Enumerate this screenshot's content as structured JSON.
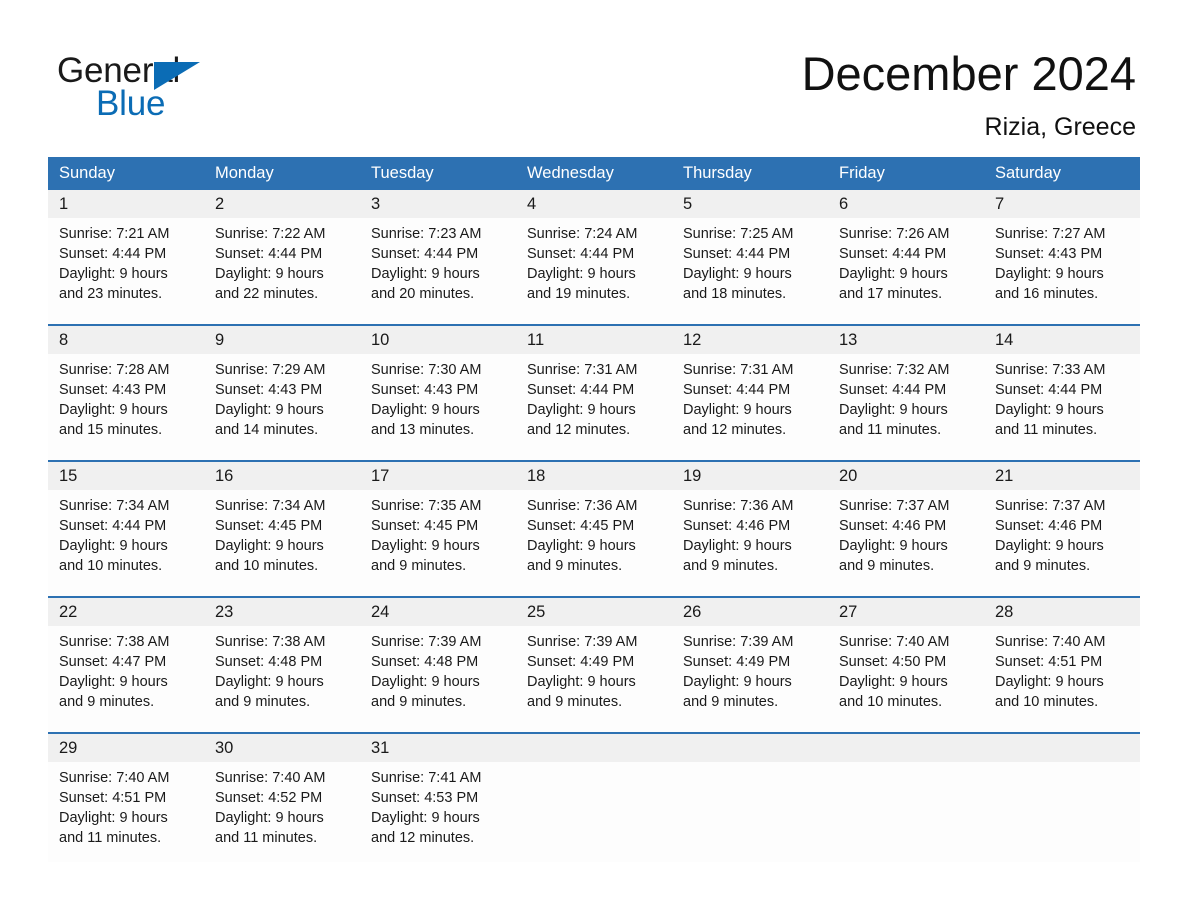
{
  "brand": {
    "name_part1": "General",
    "name_part2": "Blue",
    "triangle_color": "#0b6cb5",
    "text_color": "#1a1a1a"
  },
  "header": {
    "title": "December 2024",
    "location": "Rizia, Greece",
    "accent_color": "#2d71b2",
    "header_text_color": "#ffffff",
    "daynum_band_color": "#f0f0f0"
  },
  "weekdays": [
    "Sunday",
    "Monday",
    "Tuesday",
    "Wednesday",
    "Thursday",
    "Friday",
    "Saturday"
  ],
  "weeks": [
    {
      "days": [
        {
          "num": "1",
          "sunrise": "Sunrise: 7:21 AM",
          "sunset": "Sunset: 4:44 PM",
          "daylight1": "Daylight: 9 hours",
          "daylight2": "and 23 minutes."
        },
        {
          "num": "2",
          "sunrise": "Sunrise: 7:22 AM",
          "sunset": "Sunset: 4:44 PM",
          "daylight1": "Daylight: 9 hours",
          "daylight2": "and 22 minutes."
        },
        {
          "num": "3",
          "sunrise": "Sunrise: 7:23 AM",
          "sunset": "Sunset: 4:44 PM",
          "daylight1": "Daylight: 9 hours",
          "daylight2": "and 20 minutes."
        },
        {
          "num": "4",
          "sunrise": "Sunrise: 7:24 AM",
          "sunset": "Sunset: 4:44 PM",
          "daylight1": "Daylight: 9 hours",
          "daylight2": "and 19 minutes."
        },
        {
          "num": "5",
          "sunrise": "Sunrise: 7:25 AM",
          "sunset": "Sunset: 4:44 PM",
          "daylight1": "Daylight: 9 hours",
          "daylight2": "and 18 minutes."
        },
        {
          "num": "6",
          "sunrise": "Sunrise: 7:26 AM",
          "sunset": "Sunset: 4:44 PM",
          "daylight1": "Daylight: 9 hours",
          "daylight2": "and 17 minutes."
        },
        {
          "num": "7",
          "sunrise": "Sunrise: 7:27 AM",
          "sunset": "Sunset: 4:43 PM",
          "daylight1": "Daylight: 9 hours",
          "daylight2": "and 16 minutes."
        }
      ]
    },
    {
      "days": [
        {
          "num": "8",
          "sunrise": "Sunrise: 7:28 AM",
          "sunset": "Sunset: 4:43 PM",
          "daylight1": "Daylight: 9 hours",
          "daylight2": "and 15 minutes."
        },
        {
          "num": "9",
          "sunrise": "Sunrise: 7:29 AM",
          "sunset": "Sunset: 4:43 PM",
          "daylight1": "Daylight: 9 hours",
          "daylight2": "and 14 minutes."
        },
        {
          "num": "10",
          "sunrise": "Sunrise: 7:30 AM",
          "sunset": "Sunset: 4:43 PM",
          "daylight1": "Daylight: 9 hours",
          "daylight2": "and 13 minutes."
        },
        {
          "num": "11",
          "sunrise": "Sunrise: 7:31 AM",
          "sunset": "Sunset: 4:44 PM",
          "daylight1": "Daylight: 9 hours",
          "daylight2": "and 12 minutes."
        },
        {
          "num": "12",
          "sunrise": "Sunrise: 7:31 AM",
          "sunset": "Sunset: 4:44 PM",
          "daylight1": "Daylight: 9 hours",
          "daylight2": "and 12 minutes."
        },
        {
          "num": "13",
          "sunrise": "Sunrise: 7:32 AM",
          "sunset": "Sunset: 4:44 PM",
          "daylight1": "Daylight: 9 hours",
          "daylight2": "and 11 minutes."
        },
        {
          "num": "14",
          "sunrise": "Sunrise: 7:33 AM",
          "sunset": "Sunset: 4:44 PM",
          "daylight1": "Daylight: 9 hours",
          "daylight2": "and 11 minutes."
        }
      ]
    },
    {
      "days": [
        {
          "num": "15",
          "sunrise": "Sunrise: 7:34 AM",
          "sunset": "Sunset: 4:44 PM",
          "daylight1": "Daylight: 9 hours",
          "daylight2": "and 10 minutes."
        },
        {
          "num": "16",
          "sunrise": "Sunrise: 7:34 AM",
          "sunset": "Sunset: 4:45 PM",
          "daylight1": "Daylight: 9 hours",
          "daylight2": "and 10 minutes."
        },
        {
          "num": "17",
          "sunrise": "Sunrise: 7:35 AM",
          "sunset": "Sunset: 4:45 PM",
          "daylight1": "Daylight: 9 hours",
          "daylight2": "and 9 minutes."
        },
        {
          "num": "18",
          "sunrise": "Sunrise: 7:36 AM",
          "sunset": "Sunset: 4:45 PM",
          "daylight1": "Daylight: 9 hours",
          "daylight2": "and 9 minutes."
        },
        {
          "num": "19",
          "sunrise": "Sunrise: 7:36 AM",
          "sunset": "Sunset: 4:46 PM",
          "daylight1": "Daylight: 9 hours",
          "daylight2": "and 9 minutes."
        },
        {
          "num": "20",
          "sunrise": "Sunrise: 7:37 AM",
          "sunset": "Sunset: 4:46 PM",
          "daylight1": "Daylight: 9 hours",
          "daylight2": "and 9 minutes."
        },
        {
          "num": "21",
          "sunrise": "Sunrise: 7:37 AM",
          "sunset": "Sunset: 4:46 PM",
          "daylight1": "Daylight: 9 hours",
          "daylight2": "and 9 minutes."
        }
      ]
    },
    {
      "days": [
        {
          "num": "22",
          "sunrise": "Sunrise: 7:38 AM",
          "sunset": "Sunset: 4:47 PM",
          "daylight1": "Daylight: 9 hours",
          "daylight2": "and 9 minutes."
        },
        {
          "num": "23",
          "sunrise": "Sunrise: 7:38 AM",
          "sunset": "Sunset: 4:48 PM",
          "daylight1": "Daylight: 9 hours",
          "daylight2": "and 9 minutes."
        },
        {
          "num": "24",
          "sunrise": "Sunrise: 7:39 AM",
          "sunset": "Sunset: 4:48 PM",
          "daylight1": "Daylight: 9 hours",
          "daylight2": "and 9 minutes."
        },
        {
          "num": "25",
          "sunrise": "Sunrise: 7:39 AM",
          "sunset": "Sunset: 4:49 PM",
          "daylight1": "Daylight: 9 hours",
          "daylight2": "and 9 minutes."
        },
        {
          "num": "26",
          "sunrise": "Sunrise: 7:39 AM",
          "sunset": "Sunset: 4:49 PM",
          "daylight1": "Daylight: 9 hours",
          "daylight2": "and 9 minutes."
        },
        {
          "num": "27",
          "sunrise": "Sunrise: 7:40 AM",
          "sunset": "Sunset: 4:50 PM",
          "daylight1": "Daylight: 9 hours",
          "daylight2": "and 10 minutes."
        },
        {
          "num": "28",
          "sunrise": "Sunrise: 7:40 AM",
          "sunset": "Sunset: 4:51 PM",
          "daylight1": "Daylight: 9 hours",
          "daylight2": "and 10 minutes."
        }
      ]
    },
    {
      "days": [
        {
          "num": "29",
          "sunrise": "Sunrise: 7:40 AM",
          "sunset": "Sunset: 4:51 PM",
          "daylight1": "Daylight: 9 hours",
          "daylight2": "and 11 minutes."
        },
        {
          "num": "30",
          "sunrise": "Sunrise: 7:40 AM",
          "sunset": "Sunset: 4:52 PM",
          "daylight1": "Daylight: 9 hours",
          "daylight2": "and 11 minutes."
        },
        {
          "num": "31",
          "sunrise": "Sunrise: 7:41 AM",
          "sunset": "Sunset: 4:53 PM",
          "daylight1": "Daylight: 9 hours",
          "daylight2": "and 12 minutes."
        },
        {
          "num": "",
          "sunrise": "",
          "sunset": "",
          "daylight1": "",
          "daylight2": ""
        },
        {
          "num": "",
          "sunrise": "",
          "sunset": "",
          "daylight1": "",
          "daylight2": ""
        },
        {
          "num": "",
          "sunrise": "",
          "sunset": "",
          "daylight1": "",
          "daylight2": ""
        },
        {
          "num": "",
          "sunrise": "",
          "sunset": "",
          "daylight1": "",
          "daylight2": ""
        }
      ]
    }
  ]
}
